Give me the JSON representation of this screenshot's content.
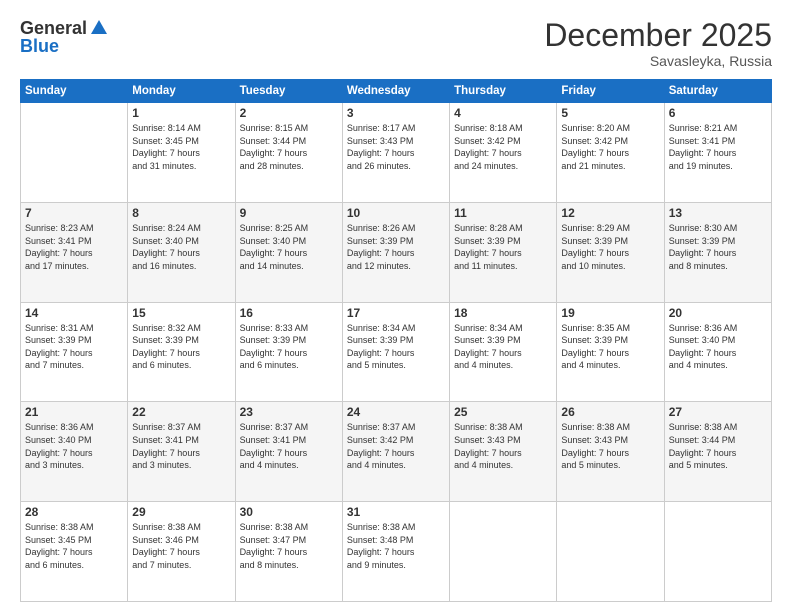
{
  "logo": {
    "general": "General",
    "blue": "Blue"
  },
  "header": {
    "month": "December 2025",
    "location": "Savasleyka, Russia"
  },
  "days_of_week": [
    "Sunday",
    "Monday",
    "Tuesday",
    "Wednesday",
    "Thursday",
    "Friday",
    "Saturday"
  ],
  "weeks": [
    [
      {
        "day": "",
        "info": ""
      },
      {
        "day": "1",
        "info": "Sunrise: 8:14 AM\nSunset: 3:45 PM\nDaylight: 7 hours\nand 31 minutes."
      },
      {
        "day": "2",
        "info": "Sunrise: 8:15 AM\nSunset: 3:44 PM\nDaylight: 7 hours\nand 28 minutes."
      },
      {
        "day": "3",
        "info": "Sunrise: 8:17 AM\nSunset: 3:43 PM\nDaylight: 7 hours\nand 26 minutes."
      },
      {
        "day": "4",
        "info": "Sunrise: 8:18 AM\nSunset: 3:42 PM\nDaylight: 7 hours\nand 24 minutes."
      },
      {
        "day": "5",
        "info": "Sunrise: 8:20 AM\nSunset: 3:42 PM\nDaylight: 7 hours\nand 21 minutes."
      },
      {
        "day": "6",
        "info": "Sunrise: 8:21 AM\nSunset: 3:41 PM\nDaylight: 7 hours\nand 19 minutes."
      }
    ],
    [
      {
        "day": "7",
        "info": "Sunrise: 8:23 AM\nSunset: 3:41 PM\nDaylight: 7 hours\nand 17 minutes."
      },
      {
        "day": "8",
        "info": "Sunrise: 8:24 AM\nSunset: 3:40 PM\nDaylight: 7 hours\nand 16 minutes."
      },
      {
        "day": "9",
        "info": "Sunrise: 8:25 AM\nSunset: 3:40 PM\nDaylight: 7 hours\nand 14 minutes."
      },
      {
        "day": "10",
        "info": "Sunrise: 8:26 AM\nSunset: 3:39 PM\nDaylight: 7 hours\nand 12 minutes."
      },
      {
        "day": "11",
        "info": "Sunrise: 8:28 AM\nSunset: 3:39 PM\nDaylight: 7 hours\nand 11 minutes."
      },
      {
        "day": "12",
        "info": "Sunrise: 8:29 AM\nSunset: 3:39 PM\nDaylight: 7 hours\nand 10 minutes."
      },
      {
        "day": "13",
        "info": "Sunrise: 8:30 AM\nSunset: 3:39 PM\nDaylight: 7 hours\nand 8 minutes."
      }
    ],
    [
      {
        "day": "14",
        "info": "Sunrise: 8:31 AM\nSunset: 3:39 PM\nDaylight: 7 hours\nand 7 minutes."
      },
      {
        "day": "15",
        "info": "Sunrise: 8:32 AM\nSunset: 3:39 PM\nDaylight: 7 hours\nand 6 minutes."
      },
      {
        "day": "16",
        "info": "Sunrise: 8:33 AM\nSunset: 3:39 PM\nDaylight: 7 hours\nand 6 minutes."
      },
      {
        "day": "17",
        "info": "Sunrise: 8:34 AM\nSunset: 3:39 PM\nDaylight: 7 hours\nand 5 minutes."
      },
      {
        "day": "18",
        "info": "Sunrise: 8:34 AM\nSunset: 3:39 PM\nDaylight: 7 hours\nand 4 minutes."
      },
      {
        "day": "19",
        "info": "Sunrise: 8:35 AM\nSunset: 3:39 PM\nDaylight: 7 hours\nand 4 minutes."
      },
      {
        "day": "20",
        "info": "Sunrise: 8:36 AM\nSunset: 3:40 PM\nDaylight: 7 hours\nand 4 minutes."
      }
    ],
    [
      {
        "day": "21",
        "info": "Sunrise: 8:36 AM\nSunset: 3:40 PM\nDaylight: 7 hours\nand 3 minutes."
      },
      {
        "day": "22",
        "info": "Sunrise: 8:37 AM\nSunset: 3:41 PM\nDaylight: 7 hours\nand 3 minutes."
      },
      {
        "day": "23",
        "info": "Sunrise: 8:37 AM\nSunset: 3:41 PM\nDaylight: 7 hours\nand 4 minutes."
      },
      {
        "day": "24",
        "info": "Sunrise: 8:37 AM\nSunset: 3:42 PM\nDaylight: 7 hours\nand 4 minutes."
      },
      {
        "day": "25",
        "info": "Sunrise: 8:38 AM\nSunset: 3:43 PM\nDaylight: 7 hours\nand 4 minutes."
      },
      {
        "day": "26",
        "info": "Sunrise: 8:38 AM\nSunset: 3:43 PM\nDaylight: 7 hours\nand 5 minutes."
      },
      {
        "day": "27",
        "info": "Sunrise: 8:38 AM\nSunset: 3:44 PM\nDaylight: 7 hours\nand 5 minutes."
      }
    ],
    [
      {
        "day": "28",
        "info": "Sunrise: 8:38 AM\nSunset: 3:45 PM\nDaylight: 7 hours\nand 6 minutes."
      },
      {
        "day": "29",
        "info": "Sunrise: 8:38 AM\nSunset: 3:46 PM\nDaylight: 7 hours\nand 7 minutes."
      },
      {
        "day": "30",
        "info": "Sunrise: 8:38 AM\nSunset: 3:47 PM\nDaylight: 7 hours\nand 8 minutes."
      },
      {
        "day": "31",
        "info": "Sunrise: 8:38 AM\nSunset: 3:48 PM\nDaylight: 7 hours\nand 9 minutes."
      },
      {
        "day": "",
        "info": ""
      },
      {
        "day": "",
        "info": ""
      },
      {
        "day": "",
        "info": ""
      }
    ]
  ]
}
